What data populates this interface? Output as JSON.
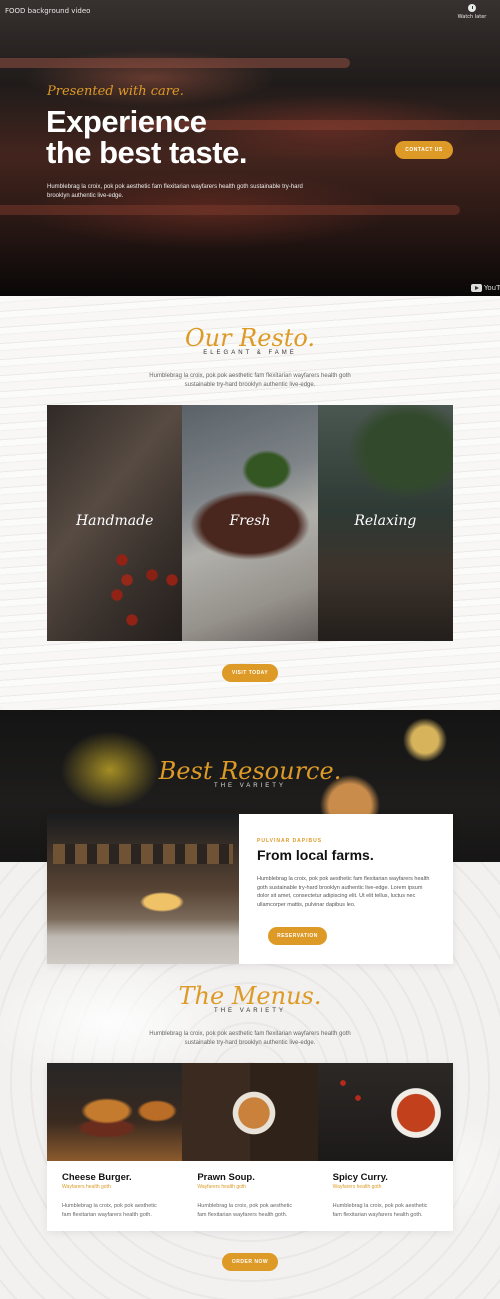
{
  "video": {
    "title": "FOOD background video",
    "watch_later": "Watch later",
    "youtube": "YouTube"
  },
  "hero": {
    "tagline": "Presented with care.",
    "heading_line1": "Experience",
    "heading_line2": "the best taste.",
    "body": "Humblebrag la croix, pok pok aesthetic fam flexitarian wayfarers health goth sustainable try-hard brooklyn authentic live-edge.",
    "cta": "CONTACT US"
  },
  "resto": {
    "title": "Our Resto.",
    "subtitle": "ELEGANT & FAME",
    "intro": "Humblebrag la croix, pok pok aesthetic fam flexitarian wayfarers health goth sustainable try-hard brooklyn authentic live-edge.",
    "panels": [
      "Handmade",
      "Fresh",
      "Relaxing"
    ],
    "cta": "VISIT TODAY"
  },
  "resource": {
    "title": "Best Resource.",
    "subtitle": "THE VARIETY",
    "eyebrow": "PULVINAR DAPIBUS",
    "heading": "From local farms.",
    "body": "Humblebrag la croix, pok pok aesthetic fam flexitarian wayfarers health goth sustainable try-hard brooklyn authentic live-edge. Lorem ipsum dolor sit amet, consectetur adipiscing elit. Ut elit tellus, luctus nec ullamcorper mattis, pulvinar dapibus leo.",
    "cta": "RESERVATION"
  },
  "menus": {
    "title": "The Menus.",
    "subtitle": "THE VARIETY",
    "intro": "Humblebrag la croix, pok pok aesthetic fam flexitarian wayfarers health goth sustainable try-hard brooklyn authentic live-edge.",
    "items": [
      {
        "name": "Cheese Burger.",
        "sub": "Wayfarers health goth",
        "desc": "Humblebrag la croix, pok pok aesthetic fam flexitarian wayfarers health goth."
      },
      {
        "name": "Prawn Soup.",
        "sub": "Wayfarers health goth",
        "desc": "Humblebrag la croix, pok pok aesthetic fam flexitarian wayfarers health goth."
      },
      {
        "name": "Spicy Curry.",
        "sub": "Wayfarers health goth",
        "desc": "Humblebrag la croix, pok pok aesthetic fam flexitarian wayfarers health goth."
      }
    ],
    "cta": "ORDER NOW"
  },
  "colors": {
    "accent": "#dd9a26",
    "dark": "#1a1a1a"
  }
}
